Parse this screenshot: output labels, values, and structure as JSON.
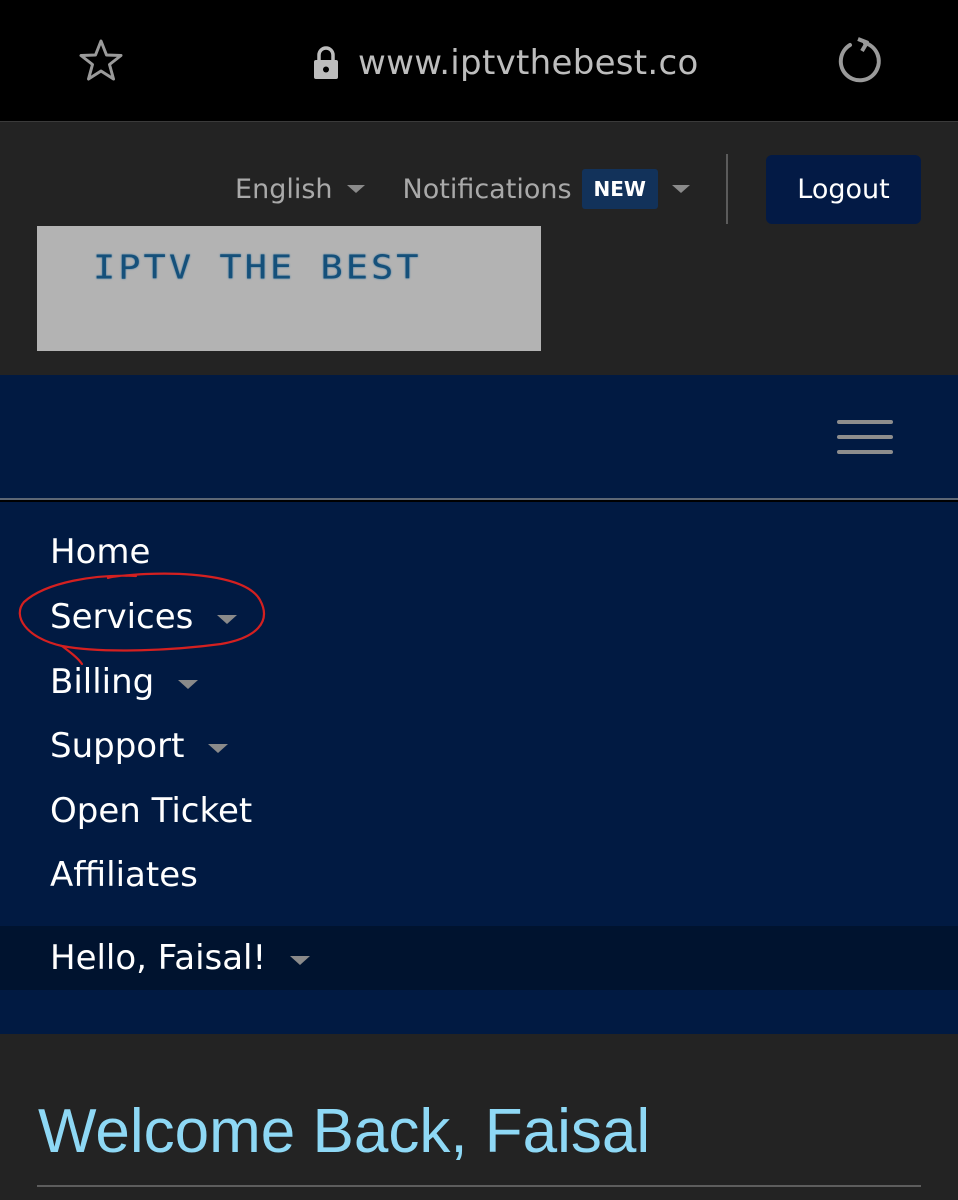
{
  "browser": {
    "url": "www.iptvthebest.co",
    "icons": [
      "star-icon",
      "lock-icon",
      "reload-icon"
    ]
  },
  "header": {
    "language_label": "English",
    "notifications_label": "Notifications",
    "notifications_badge": "NEW",
    "logout_label": "Logout",
    "logo_text": "IPTV THE BEST"
  },
  "nav": {
    "items": [
      {
        "label": "Home",
        "has_dropdown": false
      },
      {
        "label": "Services",
        "has_dropdown": true
      },
      {
        "label": "Billing",
        "has_dropdown": true
      },
      {
        "label": "Support",
        "has_dropdown": true
      },
      {
        "label": "Open Ticket",
        "has_dropdown": false
      },
      {
        "label": "Affiliates",
        "has_dropdown": false
      }
    ],
    "user_greeting": "Hello, Faisal!"
  },
  "main": {
    "welcome_title": "Welcome Back, Faisal"
  },
  "colors": {
    "nav_bg": "#011a42",
    "header_bg": "#232323",
    "welcome_text": "#8ed8f5",
    "annotation": "#d42020"
  }
}
